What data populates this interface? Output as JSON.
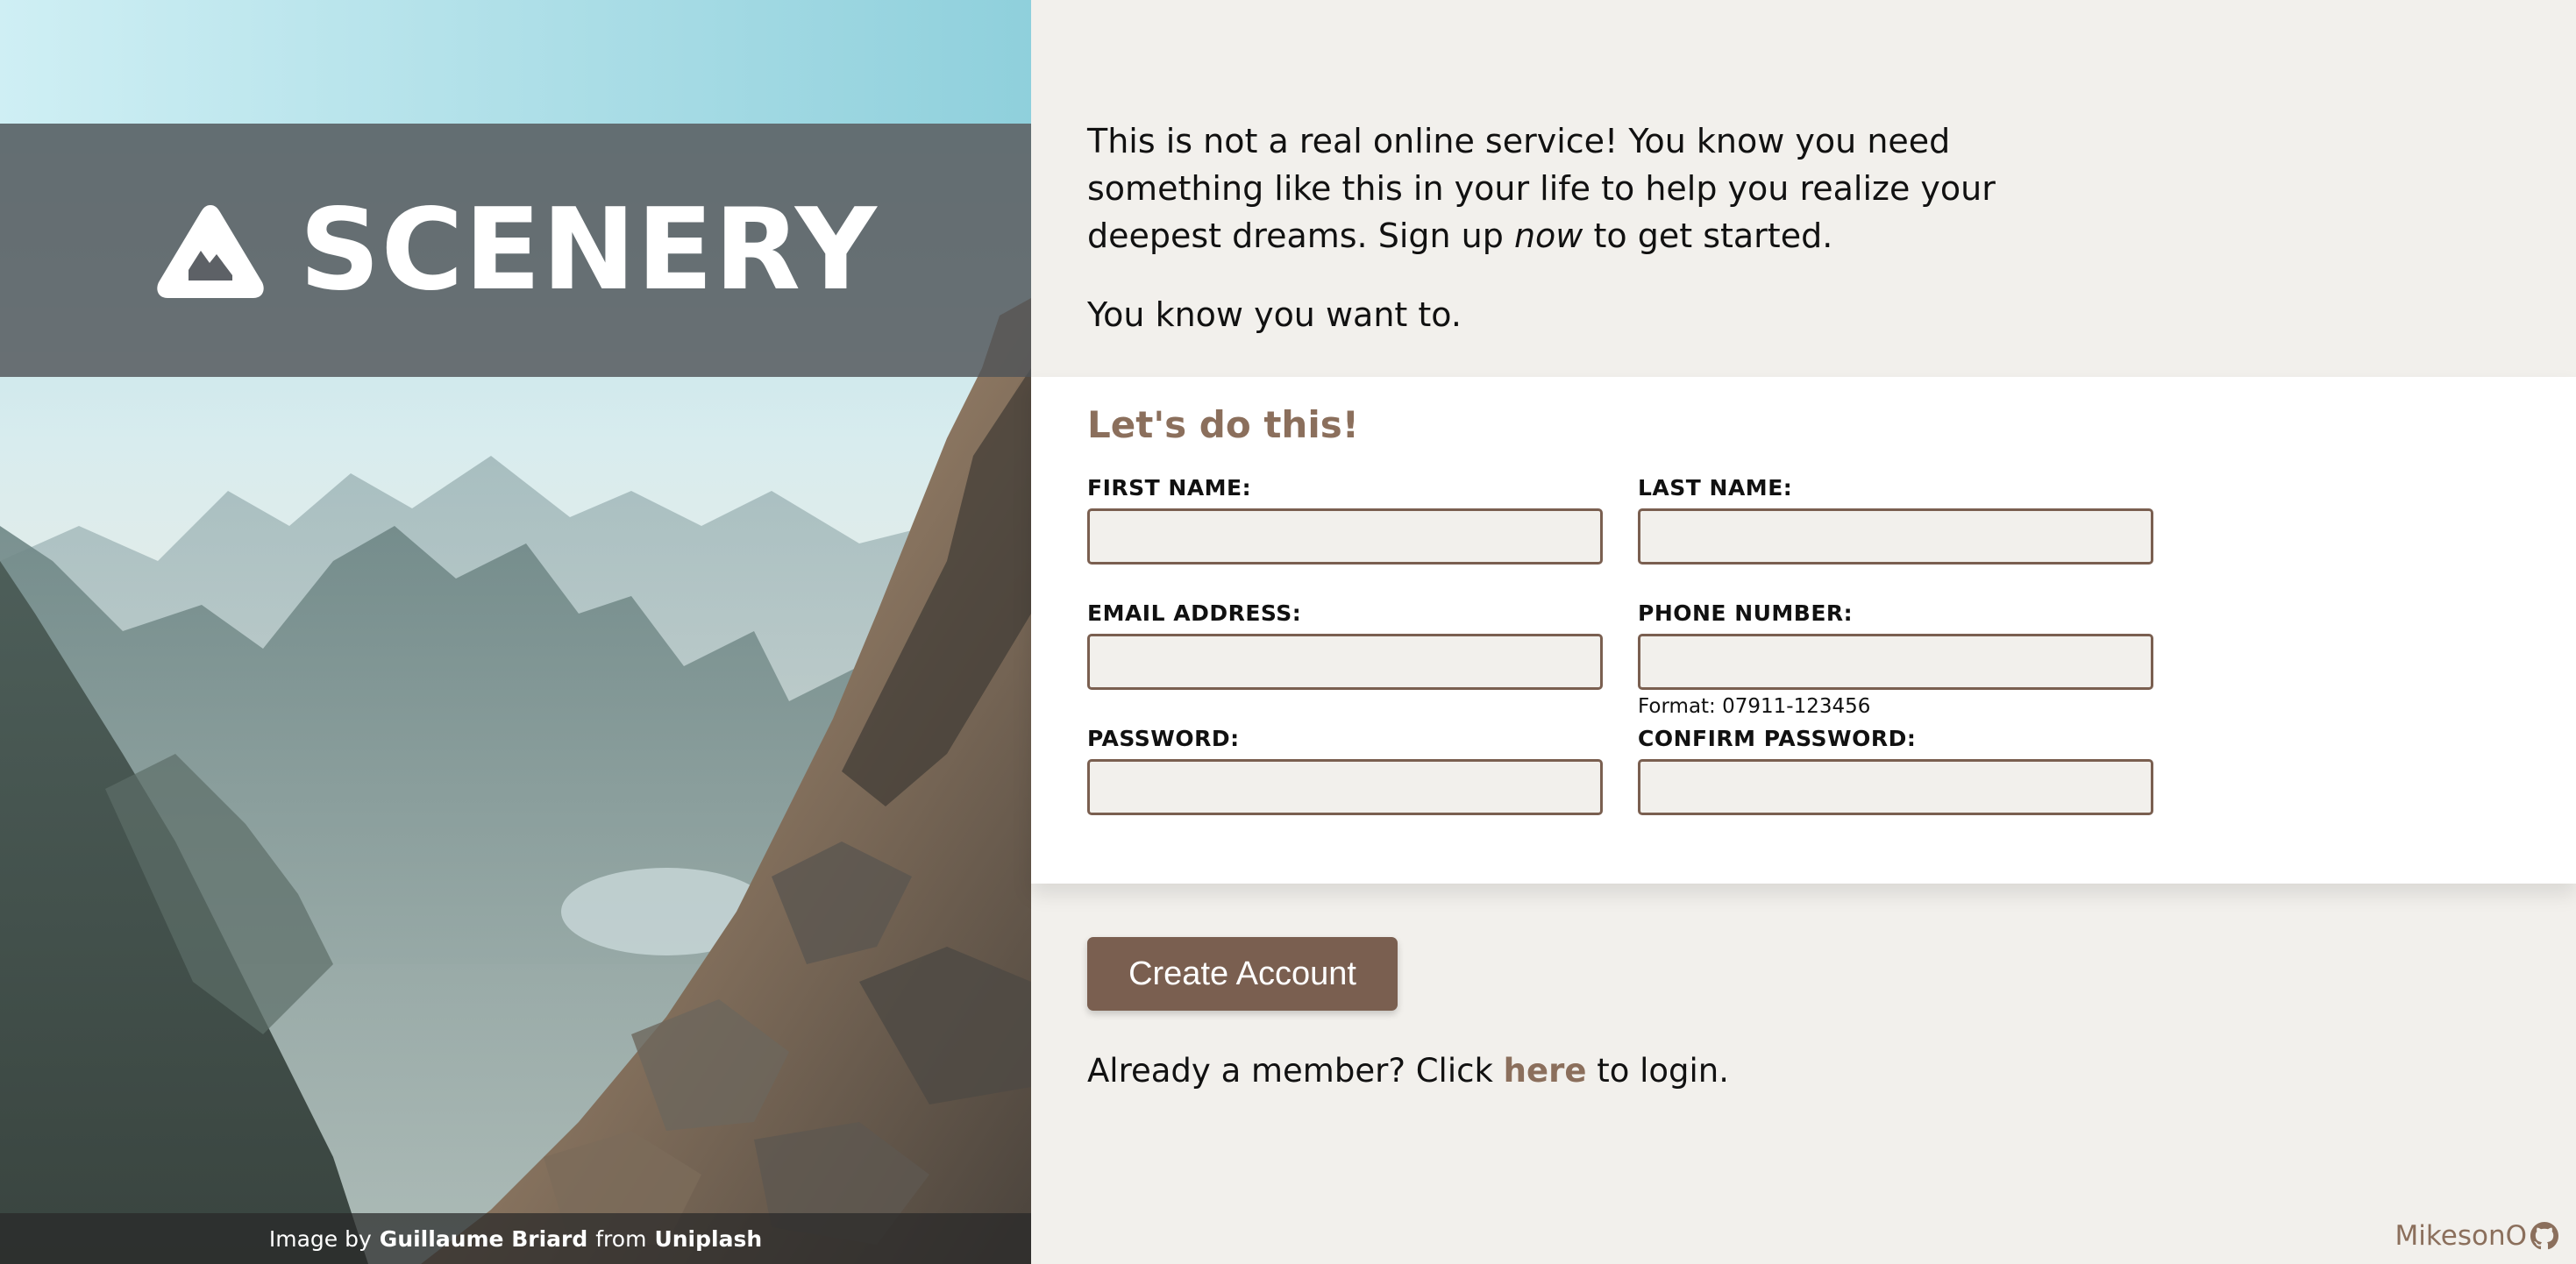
{
  "brand": {
    "name": "SCENERY"
  },
  "credit": {
    "prefix": "Image by",
    "author": "Guillaume Briard",
    "middle": "from",
    "source": "Uniplash"
  },
  "intro": {
    "paragraph1_before": "This is not a real online service! You know you need something like this in your life to help you realize your deepest dreams. Sign up",
    "paragraph1_emphasis": "now",
    "paragraph1_after": "to get started.",
    "paragraph2": "You know you want to."
  },
  "form": {
    "title": "Let's do this!",
    "first_name_label": "FIRST NAME:",
    "first_name_value": "",
    "last_name_label": "LAST NAME:",
    "last_name_value": "",
    "email_label": "EMAIL ADDRESS:",
    "email_value": "",
    "phone_label": "PHONE NUMBER:",
    "phone_value": "",
    "phone_hint": "Format: 07911-123456",
    "password_label": "PASSWORD:",
    "password_value": "",
    "confirm_password_label": "CONFIRM PASSWORD:",
    "confirm_password_value": "",
    "submit_label": "Create Account"
  },
  "login": {
    "before": "Already a member? Click",
    "link": "here",
    "after": "to login."
  },
  "footer": {
    "author": "MikesonO",
    "icon": "github-icon"
  },
  "colors": {
    "accent": "#8b6f5c",
    "button": "#7a5f50",
    "page_bg": "#f2f0ec",
    "brand_band": "#50545a"
  }
}
